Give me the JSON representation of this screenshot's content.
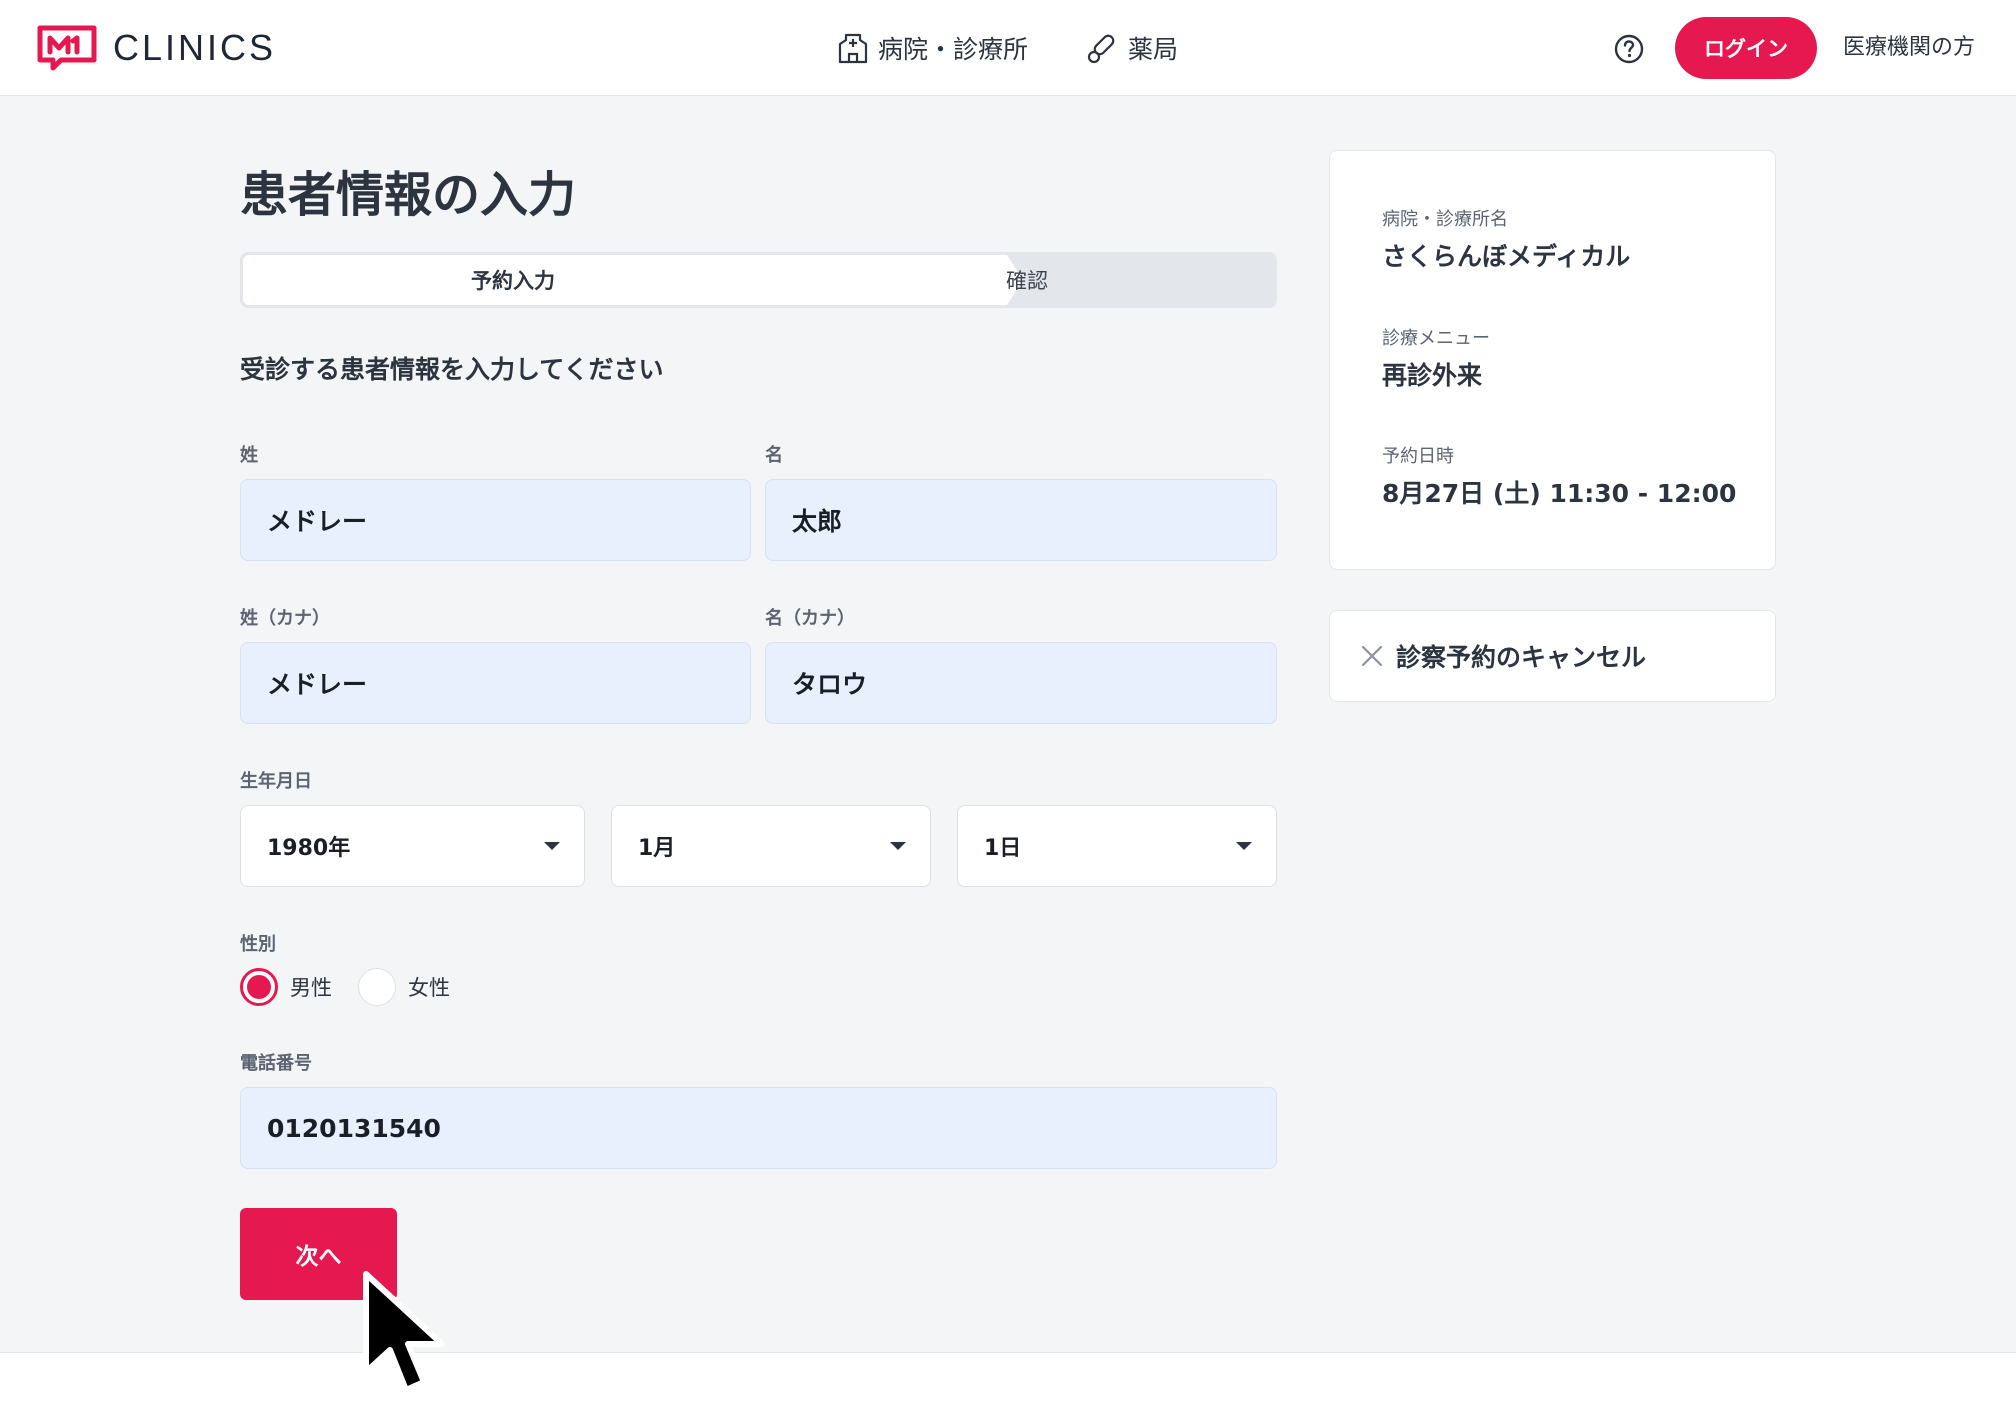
{
  "header": {
    "logo_text": "CLINICS",
    "nav": [
      {
        "label": "病院・診療所",
        "icon": "hospital-icon"
      },
      {
        "label": "薬局",
        "icon": "pill-icon"
      }
    ],
    "help_icon": "help-circle-icon",
    "login_label": "ログイン",
    "institution_link": "医療機関の方"
  },
  "colors": {
    "brand": "#e5194f",
    "input_fill": "#e8f0fe",
    "background": "#f4f5f7"
  },
  "page": {
    "title": "患者情報の入力",
    "steps": {
      "active": "予約入力",
      "next": "確認"
    },
    "instruction": "受診する患者情報を入力してください"
  },
  "form": {
    "last_name": {
      "label": "姓",
      "value": "メドレー"
    },
    "first_name": {
      "label": "名",
      "value": "太郎"
    },
    "last_name_kana": {
      "label": "姓（カナ）",
      "value": "メドレー"
    },
    "first_name_kana": {
      "label": "名（カナ）",
      "value": "タロウ"
    },
    "birthdate": {
      "label": "生年月日",
      "year": "1980年",
      "month": "1月",
      "day": "1日"
    },
    "gender": {
      "label": "性別",
      "options": [
        "男性",
        "女性"
      ],
      "selected": "男性"
    },
    "phone": {
      "label": "電話番号",
      "value": "0120131540"
    },
    "next_label": "次へ"
  },
  "summary": {
    "clinic_label": "病院・診療所名",
    "clinic_value": "さくらんぼメディカル",
    "menu_label": "診療メニュー",
    "menu_value": "再診外来",
    "datetime_label": "予約日時",
    "datetime_value": "8月27日 (土) 11:30 - 12:00"
  },
  "cancel": {
    "label": "診察予約のキャンセル",
    "icon": "close-icon"
  }
}
